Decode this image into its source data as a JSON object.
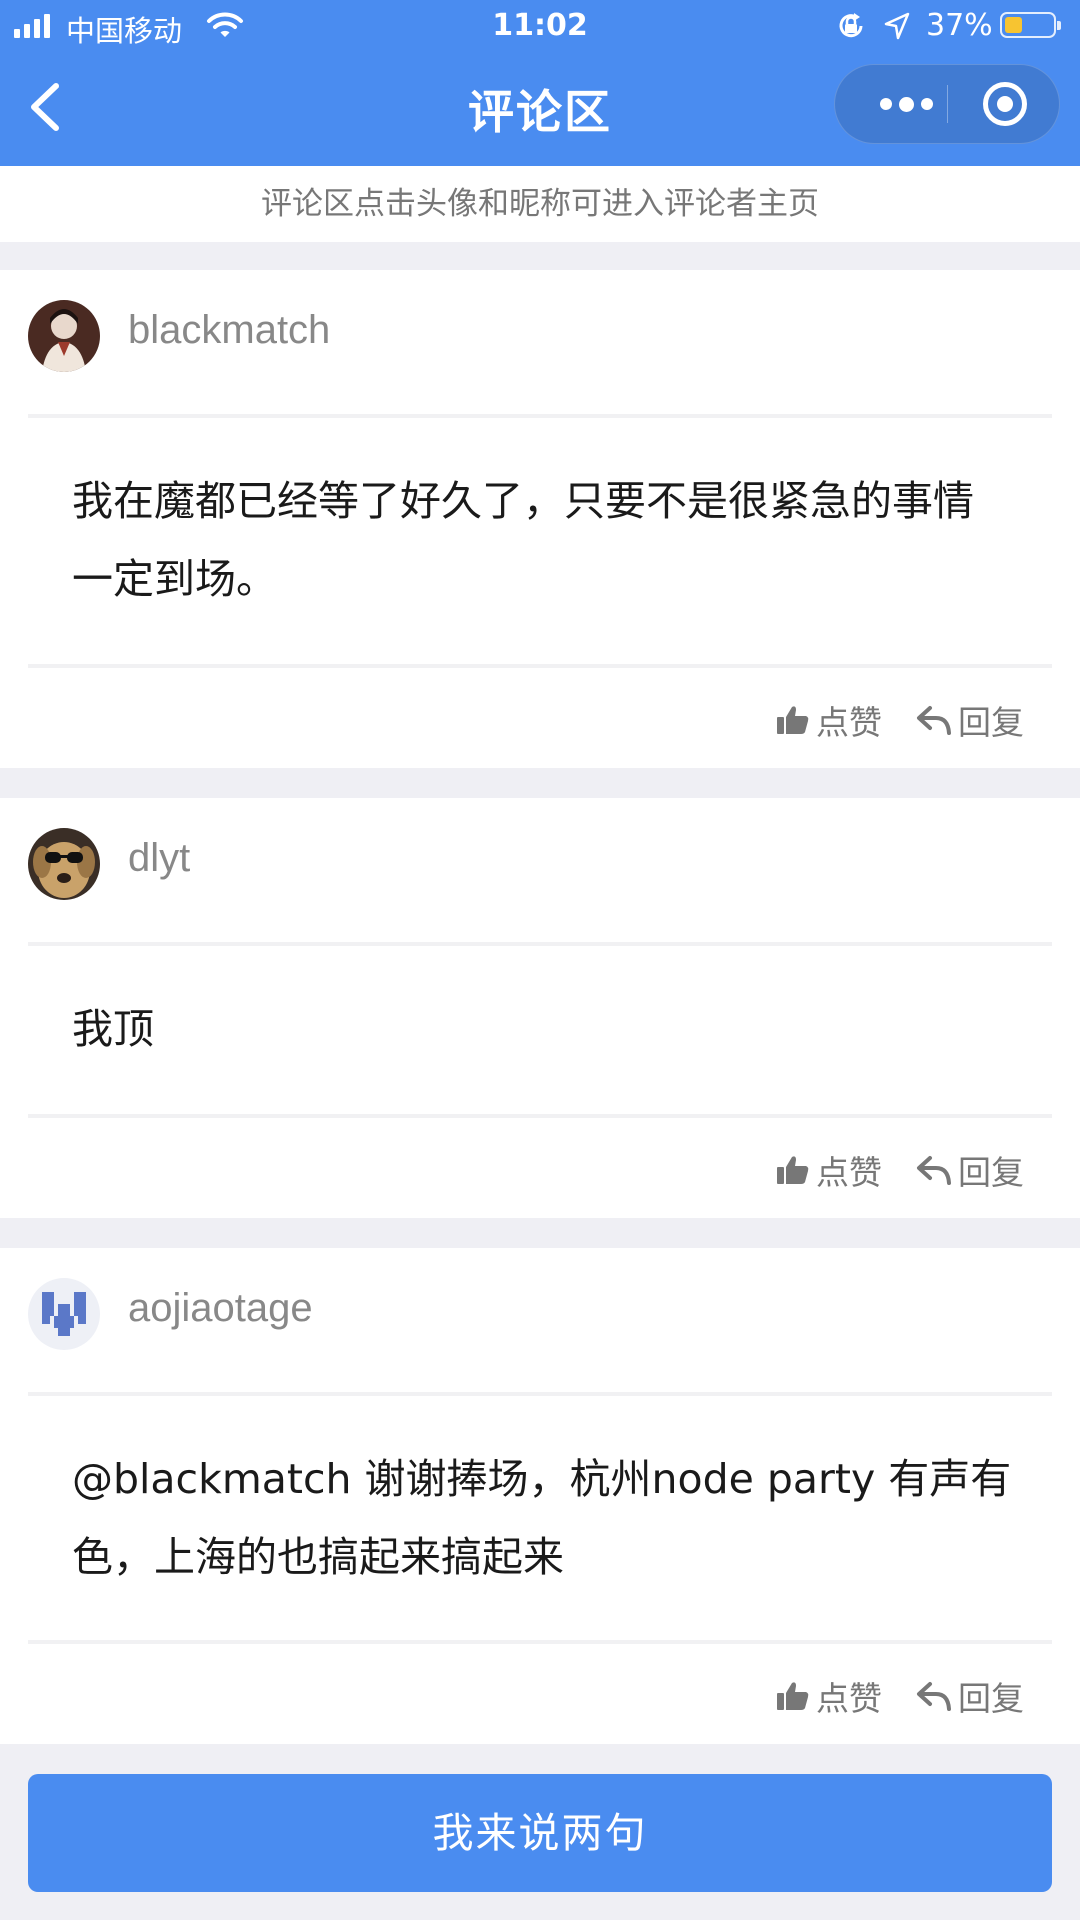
{
  "status_bar": {
    "carrier": "中国移动",
    "time": "11:02",
    "battery_percent": "37%",
    "battery_level": 0.37,
    "icons": [
      "signal-icon",
      "wifi-icon",
      "rotation-lock-icon",
      "location-arrow-icon",
      "battery-icon"
    ]
  },
  "nav": {
    "title": "评论区",
    "back_icon": "chevron-left-icon",
    "capsule_icons": [
      "more-dots-icon",
      "target-close-icon"
    ]
  },
  "tip": "评论区点击头像和昵称可进入评论者主页",
  "comments": [
    {
      "username": "blackmatch",
      "content": "我在魔都已经等了好久了，只要不是很紧急的事情一定到场。",
      "like_label": "点赞",
      "reply_label": "回复"
    },
    {
      "username": "dlyt",
      "content": "我顶",
      "like_label": "点赞",
      "reply_label": "回复"
    },
    {
      "username": "aojiaotage",
      "content": "@blackmatch 谢谢捧场，杭州node party 有声有色，上海的也搞起来搞起来",
      "like_label": "点赞",
      "reply_label": "回复"
    }
  ],
  "cta": "我来说两句",
  "colors": {
    "accent": "#4a8cf0",
    "background": "#efeff4",
    "battery": "#f7c431"
  }
}
